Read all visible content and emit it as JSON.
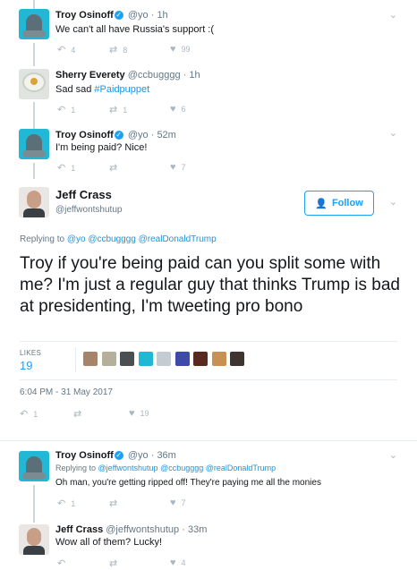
{
  "colors": {
    "accent": "#1da1f2",
    "muted": "#657786",
    "icon": "#aab8c2",
    "divider": "#e6ecf0"
  },
  "tweets": [
    {
      "name": "Troy Osinoff",
      "handle": "@yo",
      "time": "1h",
      "text": "We can't all have Russia's support :(",
      "replies": "4",
      "retweets": "8",
      "likes": "99"
    },
    {
      "name": "Sherry Everety",
      "handle": "@ccbugggg",
      "time": "1h",
      "text_prefix": "Sad sad ",
      "hashtag": "#Paidpuppet",
      "replies": "1",
      "retweets": "1",
      "likes": "6"
    },
    {
      "name": "Troy Osinoff",
      "handle": "@yo",
      "time": "52m",
      "text": "I'm being paid? Nice!",
      "replies": "1",
      "retweets": "",
      "likes": "7"
    }
  ],
  "main_tweet": {
    "name": "Jeff Crass",
    "handle": "@jeffwontshutup",
    "follow_label": "Follow",
    "replying_to_label": "Replying to",
    "replying_to": [
      "@yo",
      "@ccbugggg",
      "@realDonaldTrump"
    ],
    "text": "Troy if you're being paid can you split some with me? I'm just a regular guy that thinks Trump is bad at presidenting, I'm tweeting pro bono",
    "likes_label": "LIKES",
    "likes_count": "19",
    "timestamp": "6:04 PM - 31 May 2017",
    "replies": "1",
    "retweets": "",
    "likes": "19",
    "liker_avatars": [
      "#a6846a",
      "#b5b09a",
      "#4b4f52",
      "#21b8d6",
      "#c5ccd1",
      "#3d4aa8",
      "#5a2a22",
      "#c79154",
      "#3e3431"
    ]
  },
  "replies": [
    {
      "name": "Troy Osinoff",
      "handle": "@yo",
      "time": "36m",
      "replying_to_label": "Replying to",
      "replying_to": [
        "@jeffwontshutup",
        "@ccbugggg",
        "@realDonaldTrump"
      ],
      "text": "Oh man, you're getting ripped off! They're paying me all the monies",
      "replies": "1",
      "retweets": "",
      "likes": "7"
    },
    {
      "name": "Jeff Crass",
      "handle": "@jeffwontshutup",
      "time": "33m",
      "text": "Wow all of them? Lucky!",
      "replies": "",
      "retweets": "",
      "likes": "4"
    }
  ],
  "icons": {
    "reply": "reply-icon",
    "retweet": "retweet-icon",
    "like": "heart-icon",
    "caret": "chevron-down-icon",
    "verified": "verified-badge-icon",
    "follow": "add-user-icon"
  }
}
